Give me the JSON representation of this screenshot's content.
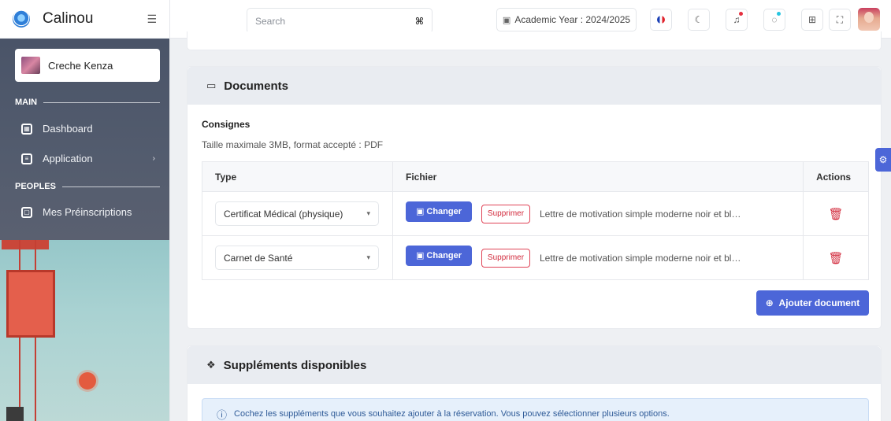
{
  "app": {
    "name": "Calinou"
  },
  "sidebar": {
    "school": "Creche Kenza",
    "sections": [
      {
        "label": "MAIN"
      },
      {
        "label": "PEOPLES"
      }
    ],
    "items": [
      {
        "label": "Dashboard",
        "icon": "dashboard-icon"
      },
      {
        "label": "Application",
        "icon": "application-icon"
      },
      {
        "label": "Mes Préinscriptions",
        "icon": "preinscriptions-icon"
      }
    ]
  },
  "header": {
    "search_placeholder": "Search",
    "search_shortcut": "⌘",
    "academic_year": "Academic Year : 2024/2025"
  },
  "documents": {
    "title": "Documents",
    "consignes_title": "Consignes",
    "consignes_text": "Taille maximale 3MB, format accepté : PDF",
    "columns": [
      "Type",
      "Fichier",
      "Actions"
    ],
    "rows": [
      {
        "type": "Certificat Médical (physique)",
        "change": "Changer",
        "delete": "Supprimer",
        "file": "Lettre de motivation simple moderne noir et bl…"
      },
      {
        "type": "Carnet de Santé",
        "change": "Changer",
        "delete": "Supprimer",
        "file": "Lettre de motivation simple moderne noir et bl…"
      }
    ],
    "add_label": "Ajouter document"
  },
  "supplements": {
    "title": "Suppléments disponibles",
    "info": "Cochez les suppléments que vous souhaitez ajouter à la réservation. Vous pouvez sélectionner plusieurs options."
  },
  "colors": {
    "primary": "#4c66d8",
    "danger": "#d22a3c",
    "sidebar": "#4a5468"
  }
}
